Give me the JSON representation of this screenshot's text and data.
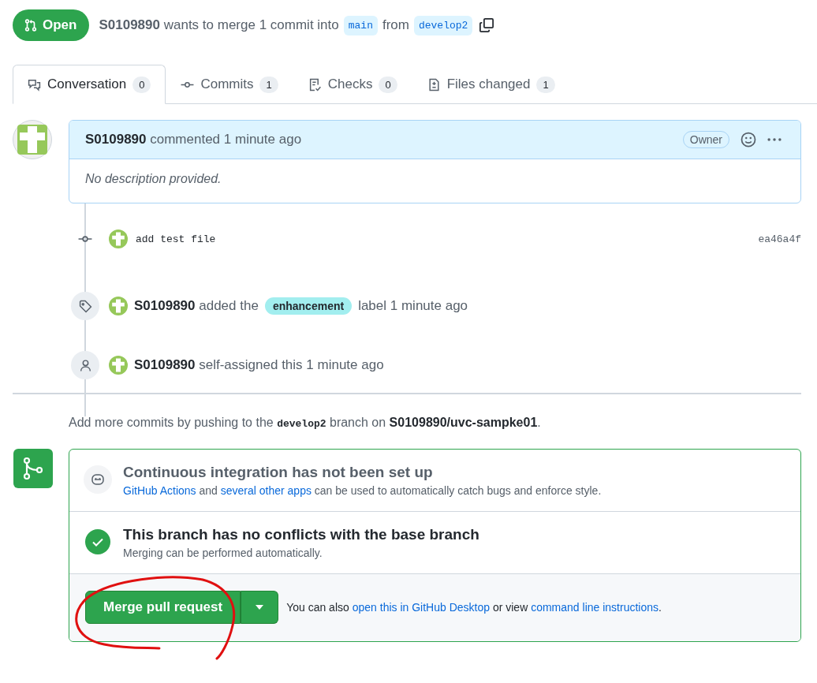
{
  "header": {
    "status": "Open",
    "author": "S0109890",
    "summary": "wants to merge 1 commit into",
    "base_branch": "main",
    "from_text": "from",
    "head_branch": "develop2"
  },
  "tabs": [
    {
      "kind": "conversation",
      "label": "Conversation",
      "count": "0",
      "selected": true
    },
    {
      "kind": "commits",
      "label": "Commits",
      "count": "1",
      "selected": false
    },
    {
      "kind": "checks",
      "label": "Checks",
      "count": "0",
      "selected": false
    },
    {
      "kind": "files",
      "label": "Files changed",
      "count": "1",
      "selected": false
    }
  ],
  "comment": {
    "author": "S0109890",
    "action": "commented 1 minute ago",
    "badge": "Owner",
    "body": "No description provided."
  },
  "timeline": [
    {
      "kind": "commit",
      "message": "add test file",
      "sha": "ea46a4f"
    },
    {
      "kind": "label",
      "author": "S0109890",
      "text_before": "added the",
      "label": "enhancement",
      "text_after": "label 1 minute ago"
    },
    {
      "kind": "assign",
      "author": "S0109890",
      "text": "self-assigned this 1 minute ago"
    }
  ],
  "push_hint": [
    {
      "kind": "text",
      "text": "Add more commits by pushing to the "
    },
    {
      "kind": "code",
      "text": "develop2"
    },
    {
      "kind": "text",
      "text": " branch on "
    },
    {
      "kind": "strong",
      "text": "S0109890/uvc-sampke01"
    },
    {
      "kind": "text",
      "text": "."
    }
  ],
  "merge_box": {
    "ci_title": "Continuous integration has not been set up",
    "ci_text": [
      {
        "kind": "link",
        "text": "GitHub Actions"
      },
      {
        "kind": "text",
        "text": " and "
      },
      {
        "kind": "link",
        "text": "several other apps"
      },
      {
        "kind": "text",
        "text": " can be used to automatically catch bugs and enforce style."
      }
    ],
    "conflict_title": "This branch has no conflicts with the base branch",
    "conflict_text": "Merging can be performed automatically.",
    "merge_button": "Merge pull request",
    "alt_text": [
      {
        "kind": "text",
        "text": "You can also "
      },
      {
        "kind": "link",
        "text": "open this in GitHub Desktop"
      },
      {
        "kind": "text",
        "text": " or view "
      },
      {
        "kind": "link",
        "text": "command line instructions"
      },
      {
        "kind": "text",
        "text": "."
      }
    ]
  }
}
